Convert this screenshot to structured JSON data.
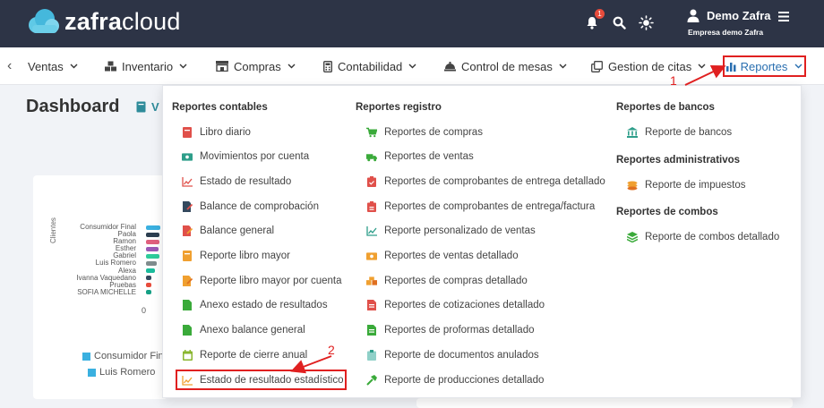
{
  "header": {
    "logo_text_bold": "zafra",
    "logo_text_light": "cloud",
    "notification_count": "1",
    "user_name": "Demo Zafra",
    "company": "Empresa demo Zafra"
  },
  "nav": {
    "items": [
      {
        "label": "Ventas",
        "icon": "none"
      },
      {
        "label": "Inventario",
        "icon": "boxes-icon"
      },
      {
        "label": "Compras",
        "icon": "store-icon"
      },
      {
        "label": "Contabilidad",
        "icon": "calculator-icon"
      },
      {
        "label": "Control de mesas",
        "icon": "bell-service-icon"
      },
      {
        "label": "Gestion de citas",
        "icon": "clone-icon"
      },
      {
        "label": "Reportes",
        "icon": "bar-chart-icon"
      }
    ]
  },
  "dashboard": {
    "title": "Dashboard",
    "button_label": "V",
    "chart": {
      "axis_label": "Clientes",
      "zero_tick": "0",
      "names": [
        "Consumidor Final",
        "Paola",
        "Ramon",
        "Esther",
        "Gabriel",
        "Luis Romero",
        "Alexa",
        "Ivanna Vaquedano",
        "Pruebas",
        "SOFIA MICHELLE"
      ],
      "legend": [
        "Consumidor Fin",
        "Luis Romero"
      ]
    }
  },
  "dropdown": {
    "col1": {
      "heading": "Reportes contables",
      "items": [
        "Libro diario",
        "Movimientos por cuenta",
        "Estado de resultado",
        "Balance de comprobación",
        "Balance general",
        "Reporte libro mayor",
        "Reporte libro mayor por cuenta",
        "Anexo estado de resultados",
        "Anexo balance general",
        "Reporte de cierre anual",
        "Estado de resultado estadístico"
      ]
    },
    "col2": {
      "heading": "Reportes registro",
      "items": [
        "Reportes de compras",
        "Reportes de ventas",
        "Reportes de comprobantes de entrega detallado",
        "Reportes de comprobantes de entrega/factura",
        "Reporte personalizado de ventas",
        "Reportes de ventas detallado",
        "Reportes de compras detallado",
        "Reportes de cotizaciones detallado",
        "Reportes de proformas detallado",
        "Reporte de documentos anulados",
        "Reporte de producciones detallado"
      ]
    },
    "col3": {
      "groups": [
        {
          "heading": "Reportes de bancos",
          "items": [
            "Reporte de bancos"
          ]
        },
        {
          "heading": "Reportes administrativos",
          "items": [
            "Reporte de impuestos"
          ]
        },
        {
          "heading": "Reportes de combos",
          "items": [
            "Reporte de combos detallado"
          ]
        }
      ]
    }
  },
  "annotations": {
    "step1": "1",
    "step2": "2"
  },
  "colors": {
    "header_bg": "#2d3446",
    "accent_blue": "#2a6fb0",
    "annotation_red": "#e02020"
  }
}
